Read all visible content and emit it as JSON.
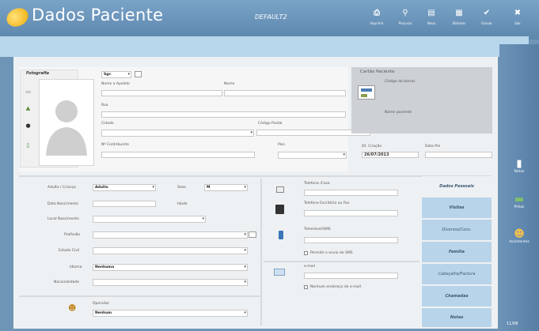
{
  "header": {
    "title": "Dados Paciente",
    "mode": "DEFAULT2",
    "toolbar": [
      {
        "icon": "print-icon",
        "glyph": "⎙",
        "label": "Imprimir"
      },
      {
        "icon": "search-icon",
        "glyph": "⚲",
        "label": "Procurar"
      },
      {
        "icon": "new-document-icon",
        "glyph": "▤",
        "label": "Novo"
      },
      {
        "icon": "delete-icon",
        "glyph": "▦",
        "label": "Eliminar"
      },
      {
        "icon": "check-icon",
        "glyph": "✔",
        "label": "Gravar"
      },
      {
        "icon": "close-icon",
        "glyph": "✖",
        "label": "Sair"
      }
    ]
  },
  "photo": {
    "label": "Fotografia"
  },
  "patient": {
    "title_value": "Sgr.",
    "first_name_label": "Nome e Apelido",
    "last_name_label": "Nome",
    "street_label": "Rua",
    "city_label": "Cidade",
    "postal_label": "Código Postal",
    "tax_label": "Nº Contribuinte",
    "country_label": "País"
  },
  "card": {
    "title": "Cartão Paciente",
    "barcode_label": "Código de barras",
    "name_label": "Nome paciente"
  },
  "dates": {
    "created_label": "Dt. Criação",
    "created_value": "26/07/2013",
    "end_label": "Data fim"
  },
  "details": {
    "adult_child_label": "Adulto / Criança",
    "adult_child_value": "Adulto",
    "sex_label": "Sexo",
    "sex_value": "M",
    "birth_date_label": "Data Nascimento",
    "age_label": "Idade",
    "birth_place_label": "Local Nascimento",
    "profession_label": "Profissão",
    "civil_status_label": "Estado Civil",
    "language_label": "Idioma",
    "language_value": "Nenhuma",
    "nationality_label": "Nacionalidade",
    "operator_label": "Operador",
    "operator_value": "Nenhum"
  },
  "contacts": {
    "home_phone_label": "Telefone /Casa",
    "office_phone_label": "Telefone Escritório ou Fax",
    "mobile_label": "Telemóvel/SMS",
    "sms_label": "Permitir o envio de SMS",
    "email_label": "e-mail",
    "no_email_label": "Nenhum endereço de e-mail"
  },
  "side_tabs": [
    "Dados Pessoais",
    "Visitas",
    "Diversos/Cons.",
    "Família",
    "Cabeçalho/Factura",
    "Chamadas",
    "Notas"
  ],
  "sidebar": [
    {
      "icon": "book-icon",
      "label": "Notas"
    },
    {
      "icon": "money-icon",
      "label": "Pilhas"
    },
    {
      "icon": "people-icon",
      "label": "Assistentes"
    }
  ],
  "status": "11/08"
}
